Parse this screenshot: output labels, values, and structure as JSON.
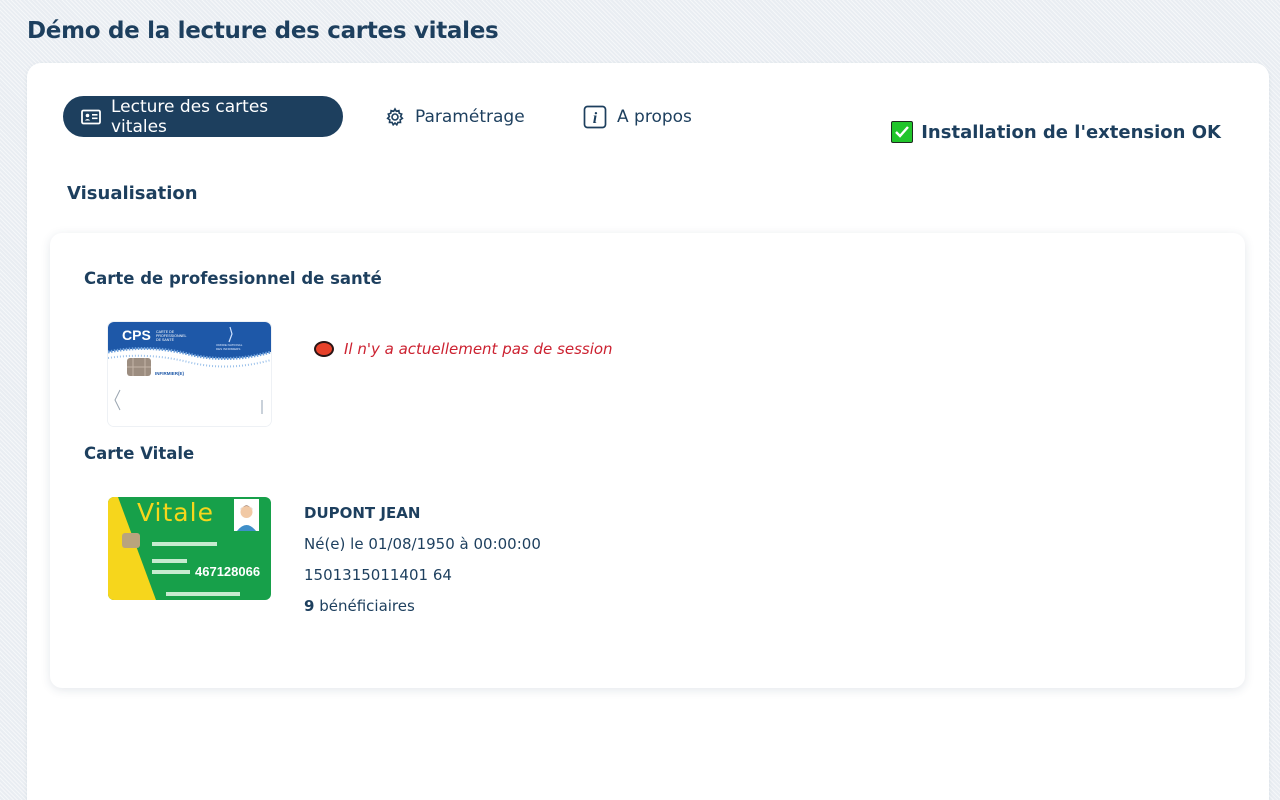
{
  "page": {
    "title": "Démo de la lecture des cartes vitales"
  },
  "tabs": [
    {
      "label": "Lecture des cartes vitales",
      "icon": "id-card-icon",
      "active": true
    },
    {
      "label": "Paramétrage",
      "icon": "gear-icon",
      "active": false
    },
    {
      "label": "A propos",
      "icon": "info-icon",
      "active": false
    }
  ],
  "extension": {
    "status": "Installation de l'extension OK",
    "icon": "checkbox-checked-icon",
    "color": "#21c52b"
  },
  "visualisation": {
    "title": "Visualisation",
    "cps": {
      "heading": "Carte de professionnel de santé",
      "card_brand": "CPS",
      "card_subtitle": "CARTE DE PROFESSIONNEL DE SANTÉ",
      "card_org": "ORDRE NATIONAL DES INFIRMIERS",
      "card_profession": "INFIRMIER(E)",
      "session_message": "Il n'y a actuellement pas de session",
      "session_status_color": "#e7412a"
    },
    "vitale": {
      "heading": "Carte Vitale",
      "card_brand": "Vitale",
      "card_number": "467128066",
      "holder_name": "DUPONT JEAN",
      "birth": "Né(e) le 01/08/1950 à 00:00:00",
      "nir": "1501315011401 64",
      "beneficiaries_count": "9",
      "beneficiaries_label": "bénéficiaires"
    }
  },
  "colors": {
    "primary": "#1d3f5e",
    "error": "#cc2231",
    "vitale_green": "#17a04a",
    "vitale_yellow": "#f6d61c"
  }
}
